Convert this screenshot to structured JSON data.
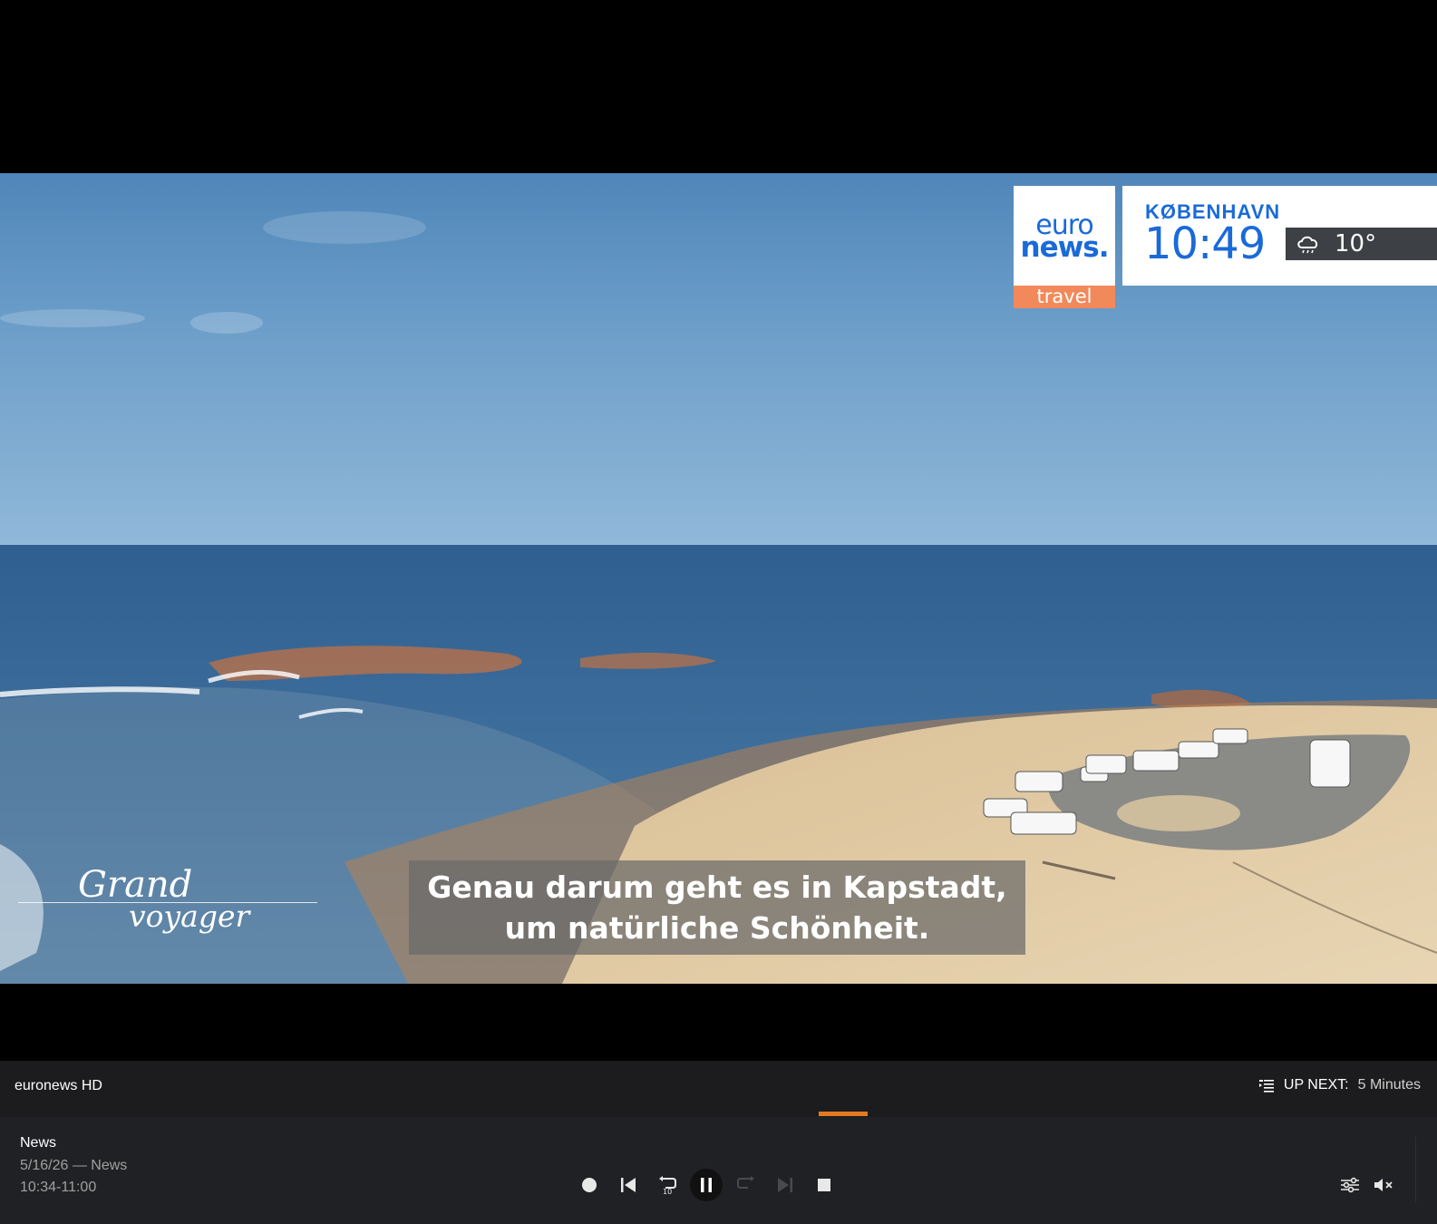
{
  "overlay": {
    "logo_euro": "euro",
    "logo_news": "news.",
    "logo_sub": "travel",
    "city": "KØBENHAVN",
    "time": "10:49",
    "temperature": "10°",
    "weather_icon": "cloud-rain-icon"
  },
  "subtitle": {
    "line1": "Genau darum geht es in Kapstadt,",
    "line2": "um natürliche Schönheit."
  },
  "show_logo": {
    "line1": "Grand",
    "line2": "voyager"
  },
  "info_bar": {
    "channel": "euronews HD",
    "up_next_label": "UP NEXT:",
    "up_next_value": "5 Minutes"
  },
  "program": {
    "title": "News",
    "meta": "5/16/26 — News",
    "time": "10:34-11:00",
    "progress": 0.575
  },
  "colors": {
    "accent": "#e27a22",
    "euronews_blue": "#1a6ad8",
    "travel_orange": "#f2895a"
  },
  "controls": [
    "record-icon",
    "skip-previous-icon",
    "replay-10-icon",
    "pause-icon",
    "forward-10-icon",
    "skip-next-icon",
    "stop-icon",
    "settings-sliders-icon",
    "mute-icon"
  ]
}
